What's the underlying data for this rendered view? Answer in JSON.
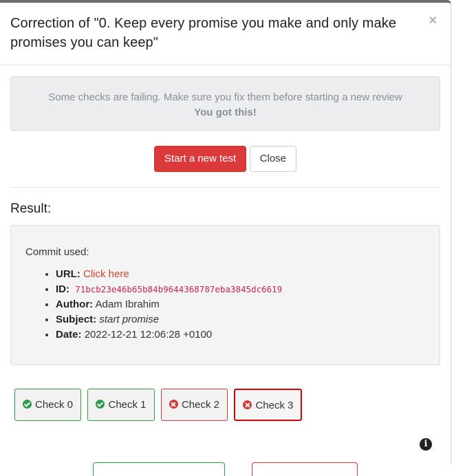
{
  "modal": {
    "title": "Correction of \"0. Keep every promise you make and only make promises you can keep\"",
    "close_symbol": "×"
  },
  "alert": {
    "message": "Some checks are failing. Make sure you fix them before starting a new review",
    "encouragement": "You got this!"
  },
  "actions": {
    "start_label": "Start a new test",
    "close_label": "Close"
  },
  "result": {
    "title": "Result:",
    "commit_label": "Commit used:",
    "fields": {
      "url_label": "URL:",
      "url_text": "Click here",
      "id_label": "ID:",
      "id_value": "71bcb23e46b65b84b9644368787eba3845dc6619",
      "author_label": "Author:",
      "author_value": "Adam Ibrahim",
      "subject_label": "Subject:",
      "subject_value": "start promise",
      "date_label": "Date:",
      "date_value": "2022-12-21 12:06:28 +0100"
    }
  },
  "checks": [
    {
      "label": "Check 0",
      "status": "pass"
    },
    {
      "label": "Check 1",
      "status": "pass"
    },
    {
      "label": "Check 2",
      "status": "fail"
    },
    {
      "label": "Check 3",
      "status": "fail"
    }
  ],
  "info_icon": {
    "glyph": "i"
  },
  "colors": {
    "danger": "#dc3a3a",
    "success": "#2e9b47",
    "link": "#d9412e"
  }
}
